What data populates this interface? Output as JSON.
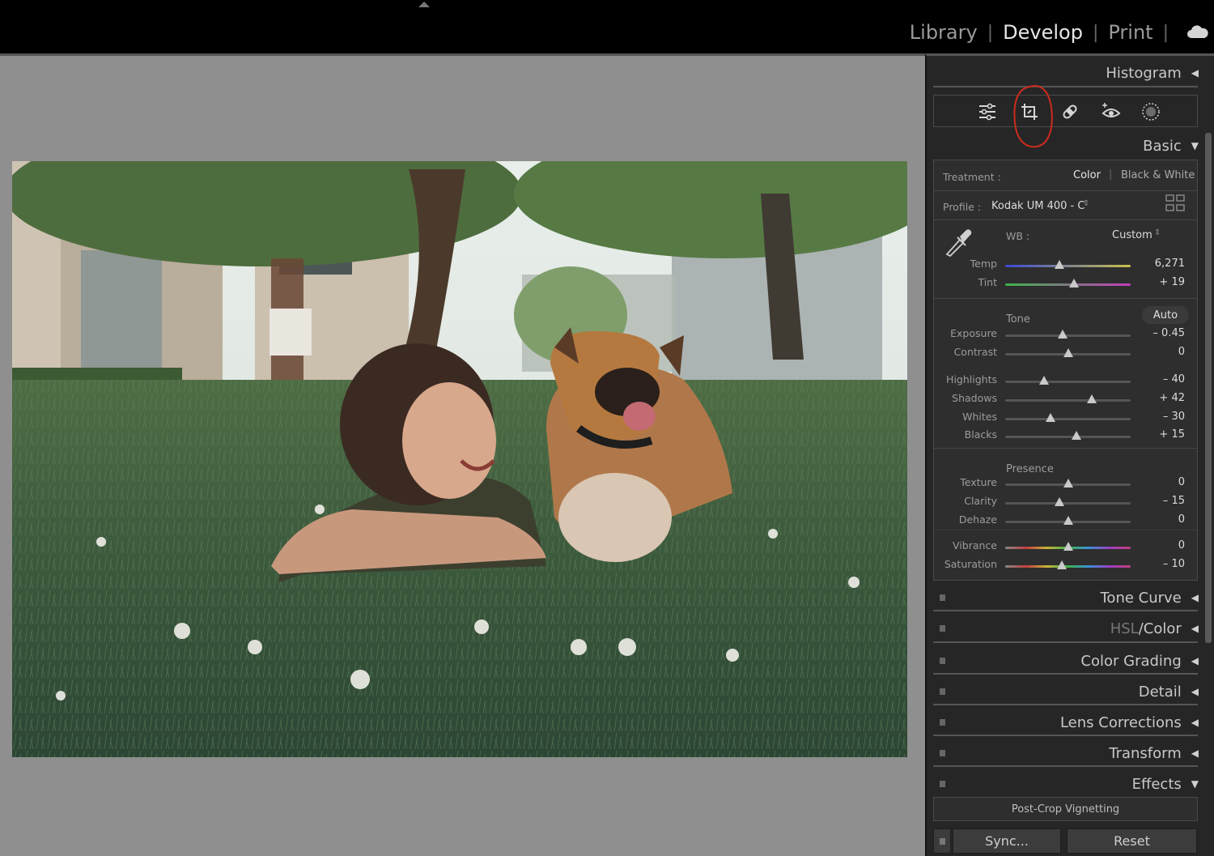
{
  "topbar": {
    "modules": [
      {
        "label": "Library",
        "active": false
      },
      {
        "label": "Develop",
        "active": true
      },
      {
        "label": "Print",
        "active": false
      }
    ],
    "separator": "|"
  },
  "panels": {
    "histogram": "Histogram",
    "basic": "Basic",
    "tone_curve": "Tone Curve",
    "hsl_dim": "HSL",
    "hsl_sep": "/",
    "hsl_color": "Color",
    "color_grading": "Color Grading",
    "detail": "Detail",
    "lens_corrections": "Lens Corrections",
    "transform": "Transform",
    "effects": "Effects",
    "post_crop": "Post-Crop Vignetting"
  },
  "tools": [
    "edit-sliders-icon",
    "crop-icon",
    "healing-icon",
    "red-eye-icon",
    "masking-icon"
  ],
  "basic": {
    "treatment_label": "Treatment :",
    "treatment_color": "Color",
    "treatment_bw": "Black & White",
    "profile_label": "Profile :",
    "profile_value": "Kodak UM 400 - C",
    "wb_label": "WB :",
    "wb_value": "Custom",
    "tone_label": "Tone",
    "auto_label": "Auto",
    "presence_label": "Presence"
  },
  "sliders": {
    "temp": {
      "label": "Temp",
      "value": "6,271",
      "pos": 0.43
    },
    "tint": {
      "label": "Tint",
      "value": "+ 19",
      "pos": 0.55
    },
    "exposure": {
      "label": "Exposure",
      "value": "– 0.45",
      "pos": 0.46
    },
    "contrast": {
      "label": "Contrast",
      "value": "0",
      "pos": 0.5
    },
    "highlights": {
      "label": "Highlights",
      "value": "– 40",
      "pos": 0.31
    },
    "shadows": {
      "label": "Shadows",
      "value": "+ 42",
      "pos": 0.69
    },
    "whites": {
      "label": "Whites",
      "value": "– 30",
      "pos": 0.36
    },
    "blacks": {
      "label": "Blacks",
      "value": "+ 15",
      "pos": 0.57
    },
    "texture": {
      "label": "Texture",
      "value": "0",
      "pos": 0.5
    },
    "clarity": {
      "label": "Clarity",
      "value": "– 15",
      "pos": 0.43
    },
    "dehaze": {
      "label": "Dehaze",
      "value": "0",
      "pos": 0.5
    },
    "vibrance": {
      "label": "Vibrance",
      "value": "0",
      "pos": 0.5
    },
    "saturation": {
      "label": "Saturation",
      "value": "– 10",
      "pos": 0.45
    }
  },
  "buttons": {
    "sync": "Sync...",
    "reset": "Reset"
  },
  "colors": {
    "annotation_circle": "#cc2b1d",
    "panel_bg": "#262626",
    "workspace_bg": "#8f8f8f"
  }
}
